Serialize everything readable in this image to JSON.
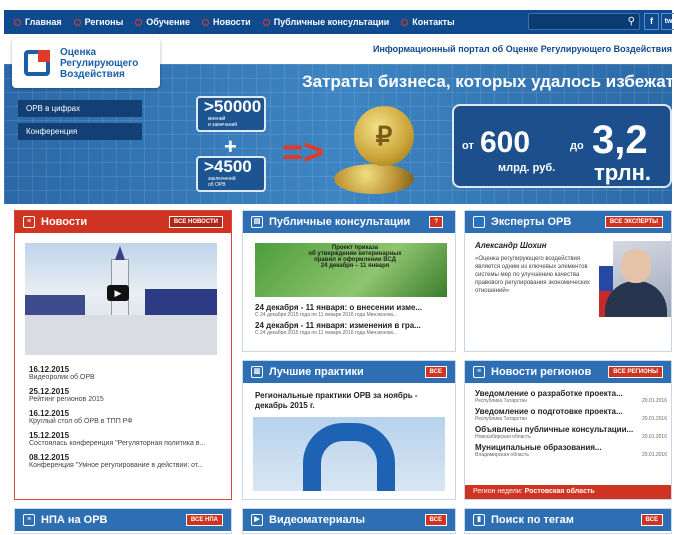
{
  "nav": {
    "items": [
      "Главная",
      "Регионы",
      "Обучение",
      "Новости",
      "Публичные консультации",
      "Контакты"
    ],
    "social": [
      "f",
      "tw"
    ]
  },
  "logo": {
    "line1": "Оценка",
    "line2": "Регулирующего",
    "line3": "Воздействия"
  },
  "portal_text": "Информационный портал об Оценке Регулирующего Воздействия",
  "banner": {
    "menu": [
      "ОРВ в цифрах",
      "Конференция"
    ],
    "headline": "Затраты бизнеса, которых удалось избежать",
    "stat1": {
      "num": ">50000",
      "label1": "мнений",
      "label2": "и замечаний"
    },
    "plus": "+",
    "stat2": {
      "num": ">4500",
      "label1": "заключений",
      "label2": "об ОРВ"
    },
    "from": "от",
    "val1": "600",
    "to": "до",
    "val2": "3,2",
    "unit1": "млрд. руб.",
    "unit2": "трлн."
  },
  "news": {
    "title": "Новости",
    "all": "ВСЕ НОВОСТИ",
    "items": [
      {
        "date": "16.12.2015",
        "text": "Видеоролик об ОРВ"
      },
      {
        "date": "25.12.2015",
        "text": "Рейтинг регионов 2015"
      },
      {
        "date": "16.12.2015",
        "text": "Круглый стол об ОРВ в ТПП РФ"
      },
      {
        "date": "15.12.2015",
        "text": "Состоялась конференция \"Регуляторная политика в..."
      },
      {
        "date": "08.12.2015",
        "text": "Конференция \"Умное регулирование в действии: от..."
      }
    ]
  },
  "consult": {
    "title": "Публичные консультации",
    "badge": "?",
    "img_text": [
      "Проект приказа",
      "об утверждении ветеринарных",
      "правил и оформлении ВСД",
      "24 декабря – 11 января"
    ],
    "items": [
      {
        "title": "24 декабря - 11 января: о внесении изме...",
        "sub": "С 24 декабря 2015 года по 11 января 2016 года Минэконом..."
      },
      {
        "title": "24 декабря - 11 января: изменения в гра...",
        "sub": "С 24 декабря 2015 года по 11 января 2016 года Минэконом..."
      }
    ]
  },
  "experts": {
    "title": "Эксперты ОРВ",
    "all": "ВСЕ ЭКСПЕРТЫ",
    "name": "Александр Шохин",
    "quote": "«Оценка регулирующего воздействия является одним из ключевых элементов системы мер по улучшению качества правового регулирования экономических отношений»"
  },
  "practices": {
    "title": "Лучшие практики",
    "all": "ВСЕ",
    "text": "Региональные практики ОРВ за ноябрь - декабрь 2015 г."
  },
  "regions": {
    "title": "Новости регионов",
    "all": "ВСЕ РЕГИОНЫ",
    "items": [
      {
        "title": "Уведомление о разработке проекта...",
        "region": "Республика Татарстан",
        "date": "20.01.2016"
      },
      {
        "title": "Уведомление о подготовке проекта...",
        "region": "Республика Татарстан",
        "date": "20.01.2016"
      },
      {
        "title": "Объявлены публичные консультации...",
        "region": "Новосибирская область",
        "date": "20.01.2016"
      },
      {
        "title": "Муниципальные образования...",
        "region": "Владимирская область",
        "date": "20.01.2016"
      }
    ],
    "week_label": "Регион недели:",
    "week_value": "Ростовская область"
  },
  "bottom": {
    "npa": {
      "title": "НПА на ОРВ",
      "all": "ВСЕ НПА"
    },
    "video": {
      "title": "Видеоматериалы",
      "all": "ВСЕ"
    },
    "tags": {
      "title": "Поиск по тегам",
      "all": "ВСЕ"
    }
  },
  "colors": {
    "nav": "#0f4a8e",
    "accent": "#cf3422",
    "panel_header": "#2e6eb3"
  }
}
